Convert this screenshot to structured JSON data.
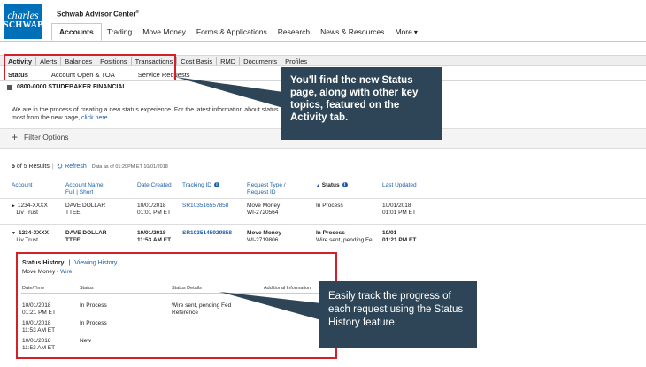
{
  "logo": {
    "line1": "charles",
    "line2": "SCHWAB"
  },
  "app_title": "Schwab Advisor Center",
  "app_title_mark": "®",
  "main_nav": [
    "Accounts",
    "Trading",
    "Move Money",
    "Forms & Applications",
    "Research",
    "News & Resources",
    "More"
  ],
  "more_chevron": "▾",
  "sub_nav": [
    "Activity",
    "Alerts",
    "Balances",
    "Positions",
    "Transactions",
    "Cost Basis",
    "RMD",
    "Documents",
    "Profiles"
  ],
  "sub_nav2": [
    "Status",
    "Account Open & TOA",
    "Service Requests"
  ],
  "account_label": "0800-0000 STUDEBAKER FINANCIAL",
  "info": {
    "text": "We are in the process of creating a new status experience. For the latest information about status",
    "text2": "most from the new page,",
    "link": "click here."
  },
  "filter_label": "Filter Options",
  "results": {
    "count": "5",
    "of_text": "of 5 Results",
    "refresh": "Refresh",
    "as_of": "Data as of 01:20PM ET 10/01/2018"
  },
  "columns": {
    "account": "Account",
    "account_name": "Account Name",
    "account_name_sub": "Full | Short",
    "date_created": "Date Created",
    "tracking_id": "Tracking ID",
    "request_type": "Request Type /",
    "request_type_sub": "Request ID",
    "status": "Status",
    "last_updated": "Last Updated"
  },
  "rows": [
    {
      "account": "1234-XXXX",
      "account_sub": "Liv Trust",
      "name": "DAVE DOLLAR",
      "name_sub": "TTEE",
      "date": "10/01/2018",
      "time": "01:01 PM ET",
      "tracking": "SR103516557858",
      "req_type": "Move Money",
      "req_id": "WI-2720564",
      "status": "In Process",
      "status_sub": "",
      "updated": "10/01/2018",
      "updated_time": "01:01 PM ET"
    },
    {
      "account": "1234-XXXX",
      "account_sub": "Liv Trust",
      "name": "DAVE DOLLAR",
      "name_sub": "TTEE",
      "date": "10/01/2018",
      "time": "11:53 AM ET",
      "tracking": "SR103514592985​8",
      "req_type": "Move Money",
      "req_id": "WI-2719806",
      "status": "In Process",
      "status_sub": "Wire sent, pending Fe...",
      "updated": "10/01",
      "updated_time": "01:21 PM ET"
    }
  ],
  "status_history": {
    "title": "Status History",
    "link": "Viewing History",
    "sub": "Move Money -",
    "sub_link": "Wire",
    "columns": [
      "Date/Time",
      "Status",
      "Status Details",
      "Additional Information"
    ],
    "entries": [
      {
        "date": "10/01/2018",
        "time": "01:21 PM ET",
        "status": "In Process",
        "details": "Wire sent, pending Fed",
        "details2": "Reference"
      },
      {
        "date": "10/01/2018",
        "time": "11:53 AM ET",
        "status": "In Process",
        "details": "",
        "details2": ""
      },
      {
        "date": "10/01/2018",
        "time": "11:53 AM ET",
        "status": "New",
        "details": "",
        "details2": ""
      }
    ]
  },
  "callouts": {
    "top": "You'll find the new Status page, along with other key topics, featured on the Activity tab.",
    "bottom": "Easily track the progress of each request using the Status History feature."
  },
  "colors": {
    "accent": "#1a5fa6",
    "highlight": "#d4202a",
    "callout": "#2d4557",
    "brand": "#0070b8"
  }
}
